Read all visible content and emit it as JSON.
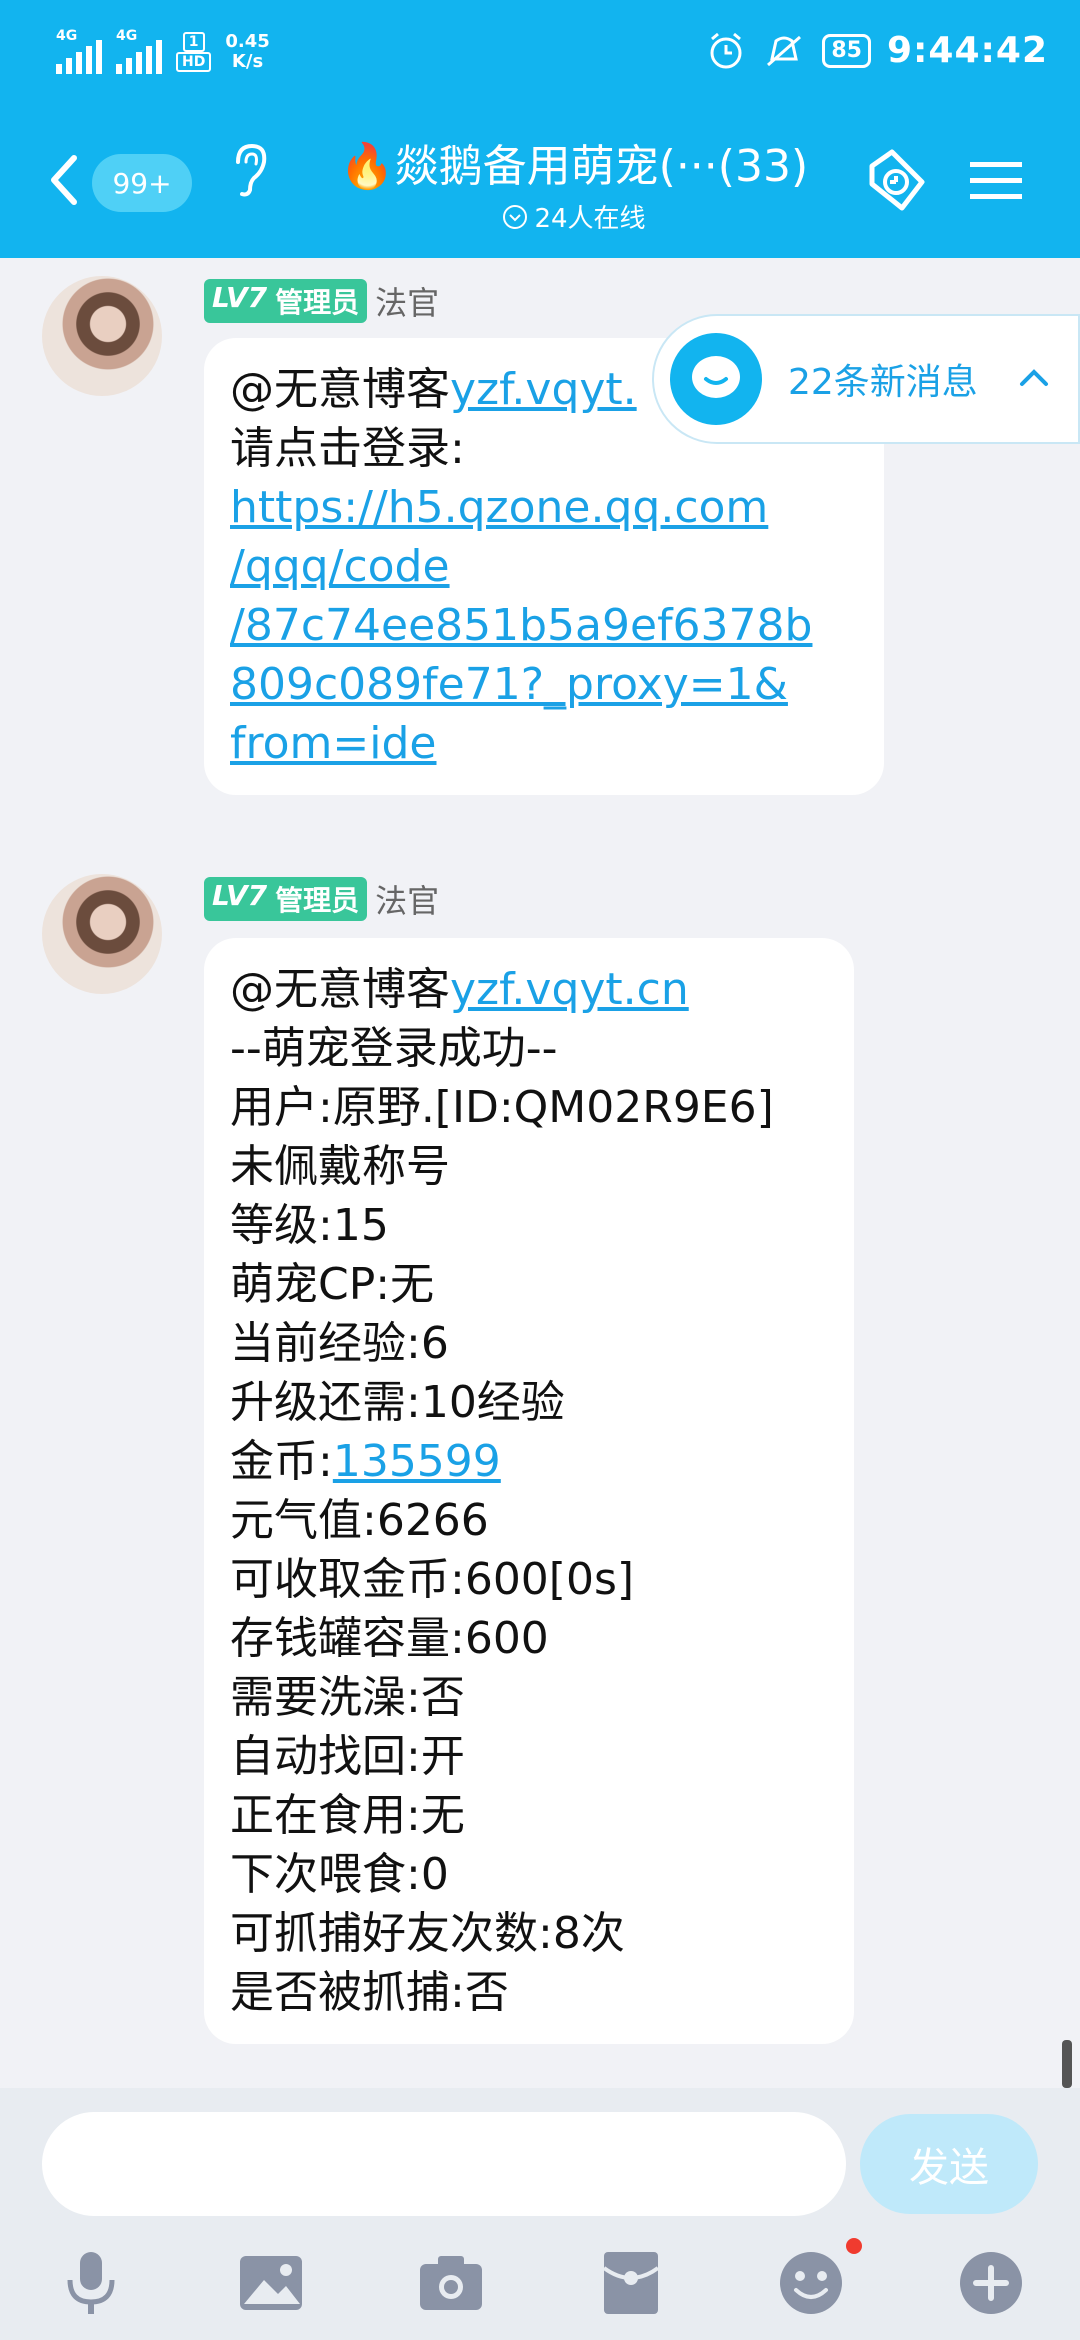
{
  "status_bar": {
    "net1": "4G",
    "net2": "4G",
    "hd_top": "1",
    "hd_bottom": "HD",
    "speed_value": "0.45",
    "speed_unit": "K/s",
    "battery": "85",
    "time": "9:44:42"
  },
  "header": {
    "unread_badge": "99+",
    "title": "🔥燚鹅备用萌宠(···(33)",
    "online": "24人在线"
  },
  "new_messages": {
    "label": "22条新消息"
  },
  "messages": [
    {
      "level": "LV7",
      "role": "管理员",
      "nickname": "法官",
      "mention": "@无意博客",
      "mention_link": "yzf.vqyt.",
      "prompt": "请点击登录:",
      "url_lines": [
        "https://h5.qzone.qq.com",
        "/qqq/code",
        "/87c74ee851b5a9ef6378b",
        "809c089fe71?_proxy=1&",
        "from=ide"
      ]
    },
    {
      "level": "LV7",
      "role": "管理员",
      "nickname": "法官",
      "mention": "@无意博客",
      "mention_link": "yzf.vqyt.cn",
      "lines": [
        "--萌宠登录成功--",
        "用户:原野.[ID:QM02R9E6]",
        "未佩戴称号",
        "等级:15",
        "萌宠CP:无",
        "当前经验:6",
        "升级还需:10经验"
      ],
      "coin_label": "金币:",
      "coin_value": "135599",
      "lines_after": [
        "元气值:6266",
        "可收取金币:600[0s]",
        "存钱罐容量:600",
        "需要洗澡:否",
        "自动找回:开",
        "正在食用:无",
        "下次喂食:0",
        "可抓捕好友次数:8次",
        "是否被抓捕:否"
      ]
    }
  ],
  "input": {
    "placeholder": "",
    "send_label": "发送"
  },
  "colors": {
    "header_bg": "#12b4ef",
    "link": "#1aa1e6",
    "level_badge": "#39c69a",
    "send_disabled": "#bfe9fa"
  }
}
